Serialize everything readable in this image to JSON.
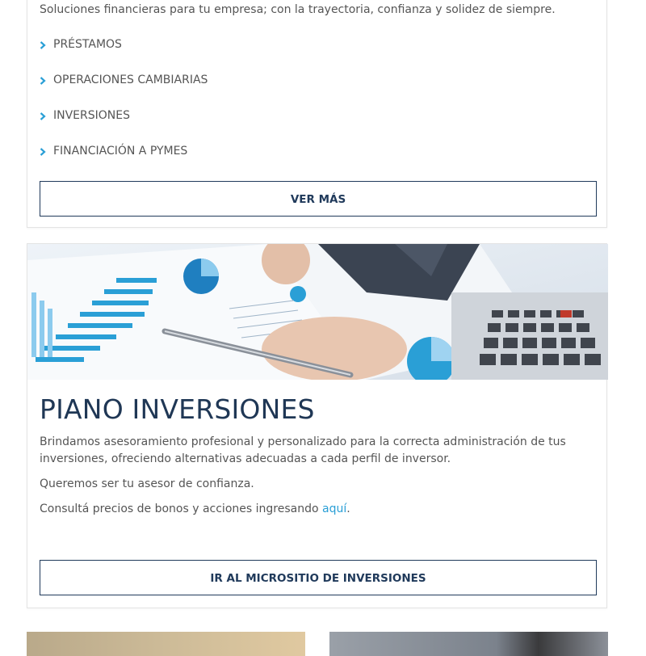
{
  "card1": {
    "intro": "Soluciones financieras para tu empresa; con la trayectoria, confianza y solidez de siempre.",
    "services": [
      {
        "label": "PRÉSTAMOS"
      },
      {
        "label": "OPERACIONES CAMBIARIAS"
      },
      {
        "label": "INVERSIONES"
      },
      {
        "label": "FINANCIACIÓN A PYMES"
      }
    ],
    "button_label": "VER MÁS"
  },
  "card2": {
    "title": "PIANO INVERSIONES",
    "description": "Brindamos asesoramiento profesional y personalizado para la correcta administración de tus inversiones, ofreciendo alternativas adecuadas a cada perfil de inversor.",
    "trust_text": "Queremos ser tu asesor de confianza.",
    "link_prefix": "Consultá precios de bonos y acciones ingresando ",
    "link_text": "aquí",
    "link_suffix": ".",
    "button_label": "IR AL MICROSITIO DE INVERSIONES"
  },
  "icons": {
    "list_bullet": "chevron-right-icon"
  },
  "colors": {
    "accent": "#2a9fd6",
    "navy": "#203a5b",
    "text": "#555555",
    "border": "#e4e4e4"
  }
}
